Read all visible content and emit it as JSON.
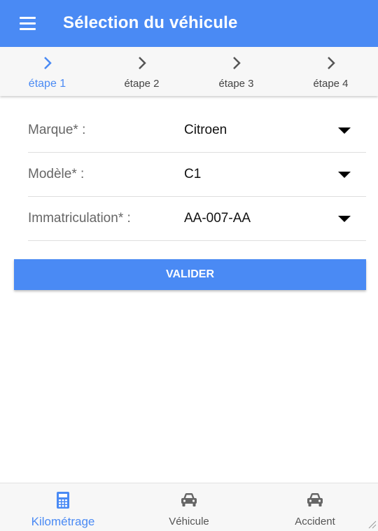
{
  "app_bar": {
    "title": "Sélection du véhicule",
    "menu_icon": "hamburger-menu-icon",
    "color": "#4a8af4"
  },
  "stepper": {
    "steps": [
      {
        "label": "étape 1",
        "active": true
      },
      {
        "label": "étape 2",
        "active": false
      },
      {
        "label": "étape 3",
        "active": false
      },
      {
        "label": "étape 4",
        "active": false
      }
    ],
    "active_color": "#4a8af4"
  },
  "form": {
    "fields": [
      {
        "label": "Marque* :",
        "value": "Citroen"
      },
      {
        "label": "Modèle* :",
        "value": "C1"
      },
      {
        "label": "Immatriculation* :",
        "value": "AA-007-AA"
      }
    ],
    "submit_label": "VALIDER"
  },
  "bottom_nav": {
    "items": [
      {
        "label": "Kilométrage",
        "icon": "calculator-icon",
        "active": true
      },
      {
        "label": "Véhicule",
        "icon": "car-icon",
        "active": false
      },
      {
        "label": "Accident",
        "icon": "car-icon",
        "active": false
      }
    ]
  }
}
